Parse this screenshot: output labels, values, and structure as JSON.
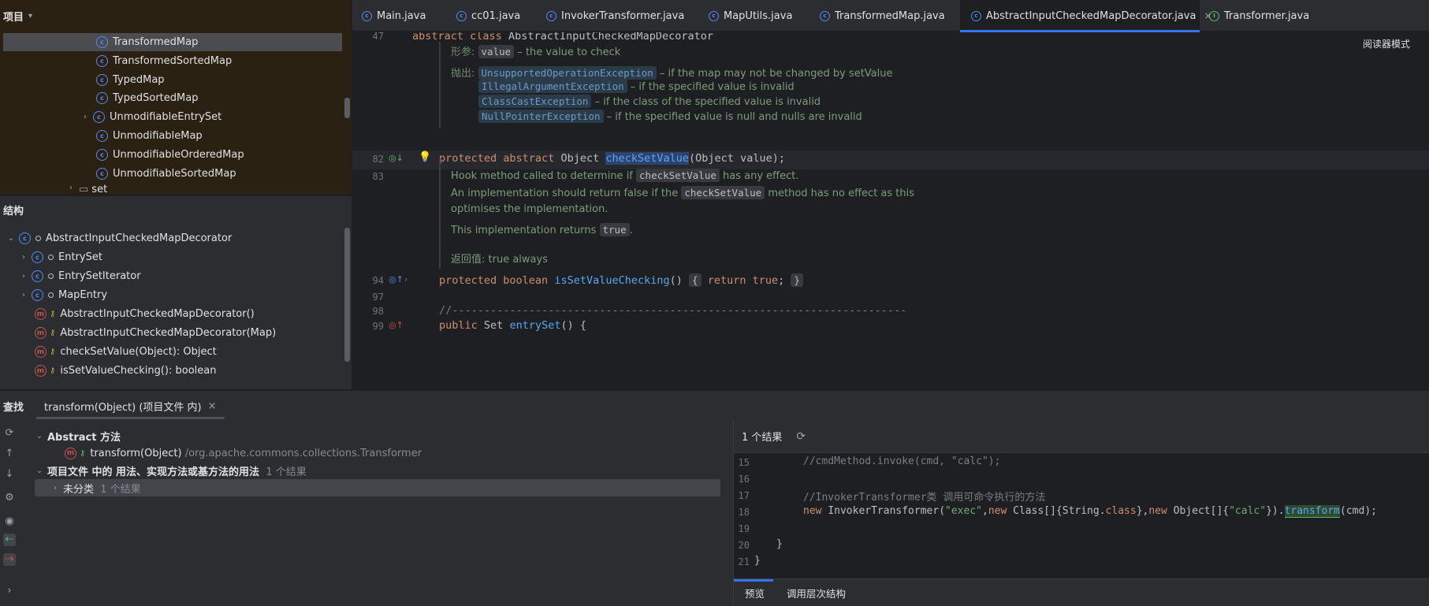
{
  "project": {
    "header": "项目",
    "items": [
      {
        "label": "TransformedMap",
        "selected": true
      },
      {
        "label": "TransformedSortedMap"
      },
      {
        "label": "TypedMap"
      },
      {
        "label": "TypedSortedMap"
      },
      {
        "label": "UnmodifiableEntrySet",
        "expandable": true
      },
      {
        "label": "UnmodifiableMap"
      },
      {
        "label": "UnmodifiableOrderedMap"
      },
      {
        "label": "UnmodifiableSortedMap"
      },
      {
        "label": "set"
      }
    ]
  },
  "structure": {
    "header": "结构",
    "root": "AbstractInputCheckedMapDecorator",
    "inner_classes": [
      "EntrySet",
      "EntrySetIterator",
      "MapEntry"
    ],
    "methods": [
      "AbstractInputCheckedMapDecorator()",
      "AbstractInputCheckedMapDecorator(Map)",
      "checkSetValue(Object): Object",
      "isSetValueChecking(): boolean"
    ]
  },
  "tabs": [
    {
      "label": "Main.java",
      "icon": "class"
    },
    {
      "label": "cc01.java",
      "icon": "class"
    },
    {
      "label": "InvokerTransformer.java",
      "icon": "class"
    },
    {
      "label": "MapUtils.java",
      "icon": "class"
    },
    {
      "label": "TransformedMap.java",
      "icon": "class"
    },
    {
      "label": "AbstractInputCheckedMapDecorator.java",
      "icon": "class",
      "active": true,
      "close": "×"
    },
    {
      "label": "Transformer.java",
      "icon": "interface"
    }
  ],
  "editor": {
    "reader_mode": "阅读器模式",
    "line_numbers": {
      "l47": "47",
      "l82": "82",
      "l83": "83",
      "l94": "94",
      "l97": "97",
      "l98": "98",
      "l99": "99"
    },
    "sticky_kw": "abstract class",
    "sticky_name": "AbstractInputCheckedMapDecorator",
    "doc1": {
      "param_label": "形参:",
      "param_code": "value",
      "param_text": "– the value to check",
      "throws_label": "抛出:",
      "throws": [
        {
          "code": "UnsupportedOperationException",
          "text": "– if the map may not be changed by setValue"
        },
        {
          "code": "IllegalArgumentException",
          "text": "– if the specified value is invalid"
        },
        {
          "code": "ClassCastException",
          "text": "– if the class of the specified value is invalid"
        },
        {
          "code": "NullPointerException",
          "text": "– if the specified value is null and nulls are invalid"
        }
      ]
    },
    "line82": {
      "kw": "protected abstract",
      "type": "Object",
      "name": "checkSetValue",
      "rest": "(Object value);"
    },
    "doc2": {
      "p1_a": "Hook method called to determine if",
      "p1_code": "checkSetValue",
      "p1_b": "has any effect.",
      "p2_a": "An implementation should return false if the",
      "p2_code": "checkSetValue",
      "p2_b": "method has no effect as this",
      "p3": "optimises the implementation.",
      "p4_a": "This implementation returns",
      "p4_code": "true",
      "p4_b": ".",
      "returns": "返回值: true always"
    },
    "line94": {
      "kw": "protected boolean",
      "name": "isSetValueChecking",
      "paren": "()",
      "ob": "{",
      "ret": "return",
      "val": "true",
      "semi": ";",
      "cb": "}"
    },
    "line98": "//-----------------------------------------------------------------------",
    "line99": {
      "kw": "public",
      "rest": "Set",
      "name": "entrySet",
      "tail": "() {"
    }
  },
  "find": {
    "title": "查找",
    "tab_label": "transform(Object) (项目文件 内)",
    "tab_close": "×",
    "group1": "Abstract 方法",
    "group1_item": "transform(Object)",
    "group1_item_path": "/org.apache.commons.collections.Transformer",
    "group2": "项目文件 中的 用法、实现方法或基方法的用法",
    "group2_count": "1 个结果",
    "group2_child": "未分类",
    "group2_child_count": "1 个结果"
  },
  "preview": {
    "result_count": "1 个结果",
    "lines": {
      "n15": "15",
      "n16": "16",
      "n17": "17",
      "n18": "18",
      "n19": "19",
      "n20": "20",
      "n21": "21"
    },
    "l15": "//cmdMethod.invoke(cmd, \"calc\");",
    "l17": "//InvokerTransformer类 调用可命令执行的方法",
    "l18": {
      "kw1": "new",
      "cls": "InvokerTransformer(",
      "s1": "\"exec\"",
      "c1": ",",
      "kw2": "new",
      "c2": "Class[]{String.",
      "kw3": "class",
      "c3": "},",
      "kw4": "new",
      "c4": "Object[]{",
      "s2": "\"calc\"",
      "c5": "}).",
      "fn": "transform",
      "c6": "(cmd);"
    },
    "l20": "}",
    "l21": "}",
    "tabs": [
      "预览",
      "调用层次结构"
    ]
  },
  "colors": {
    "accent": "#3574f0",
    "project_bg": "#2b2112",
    "editor_bg": "#1e1f22"
  }
}
